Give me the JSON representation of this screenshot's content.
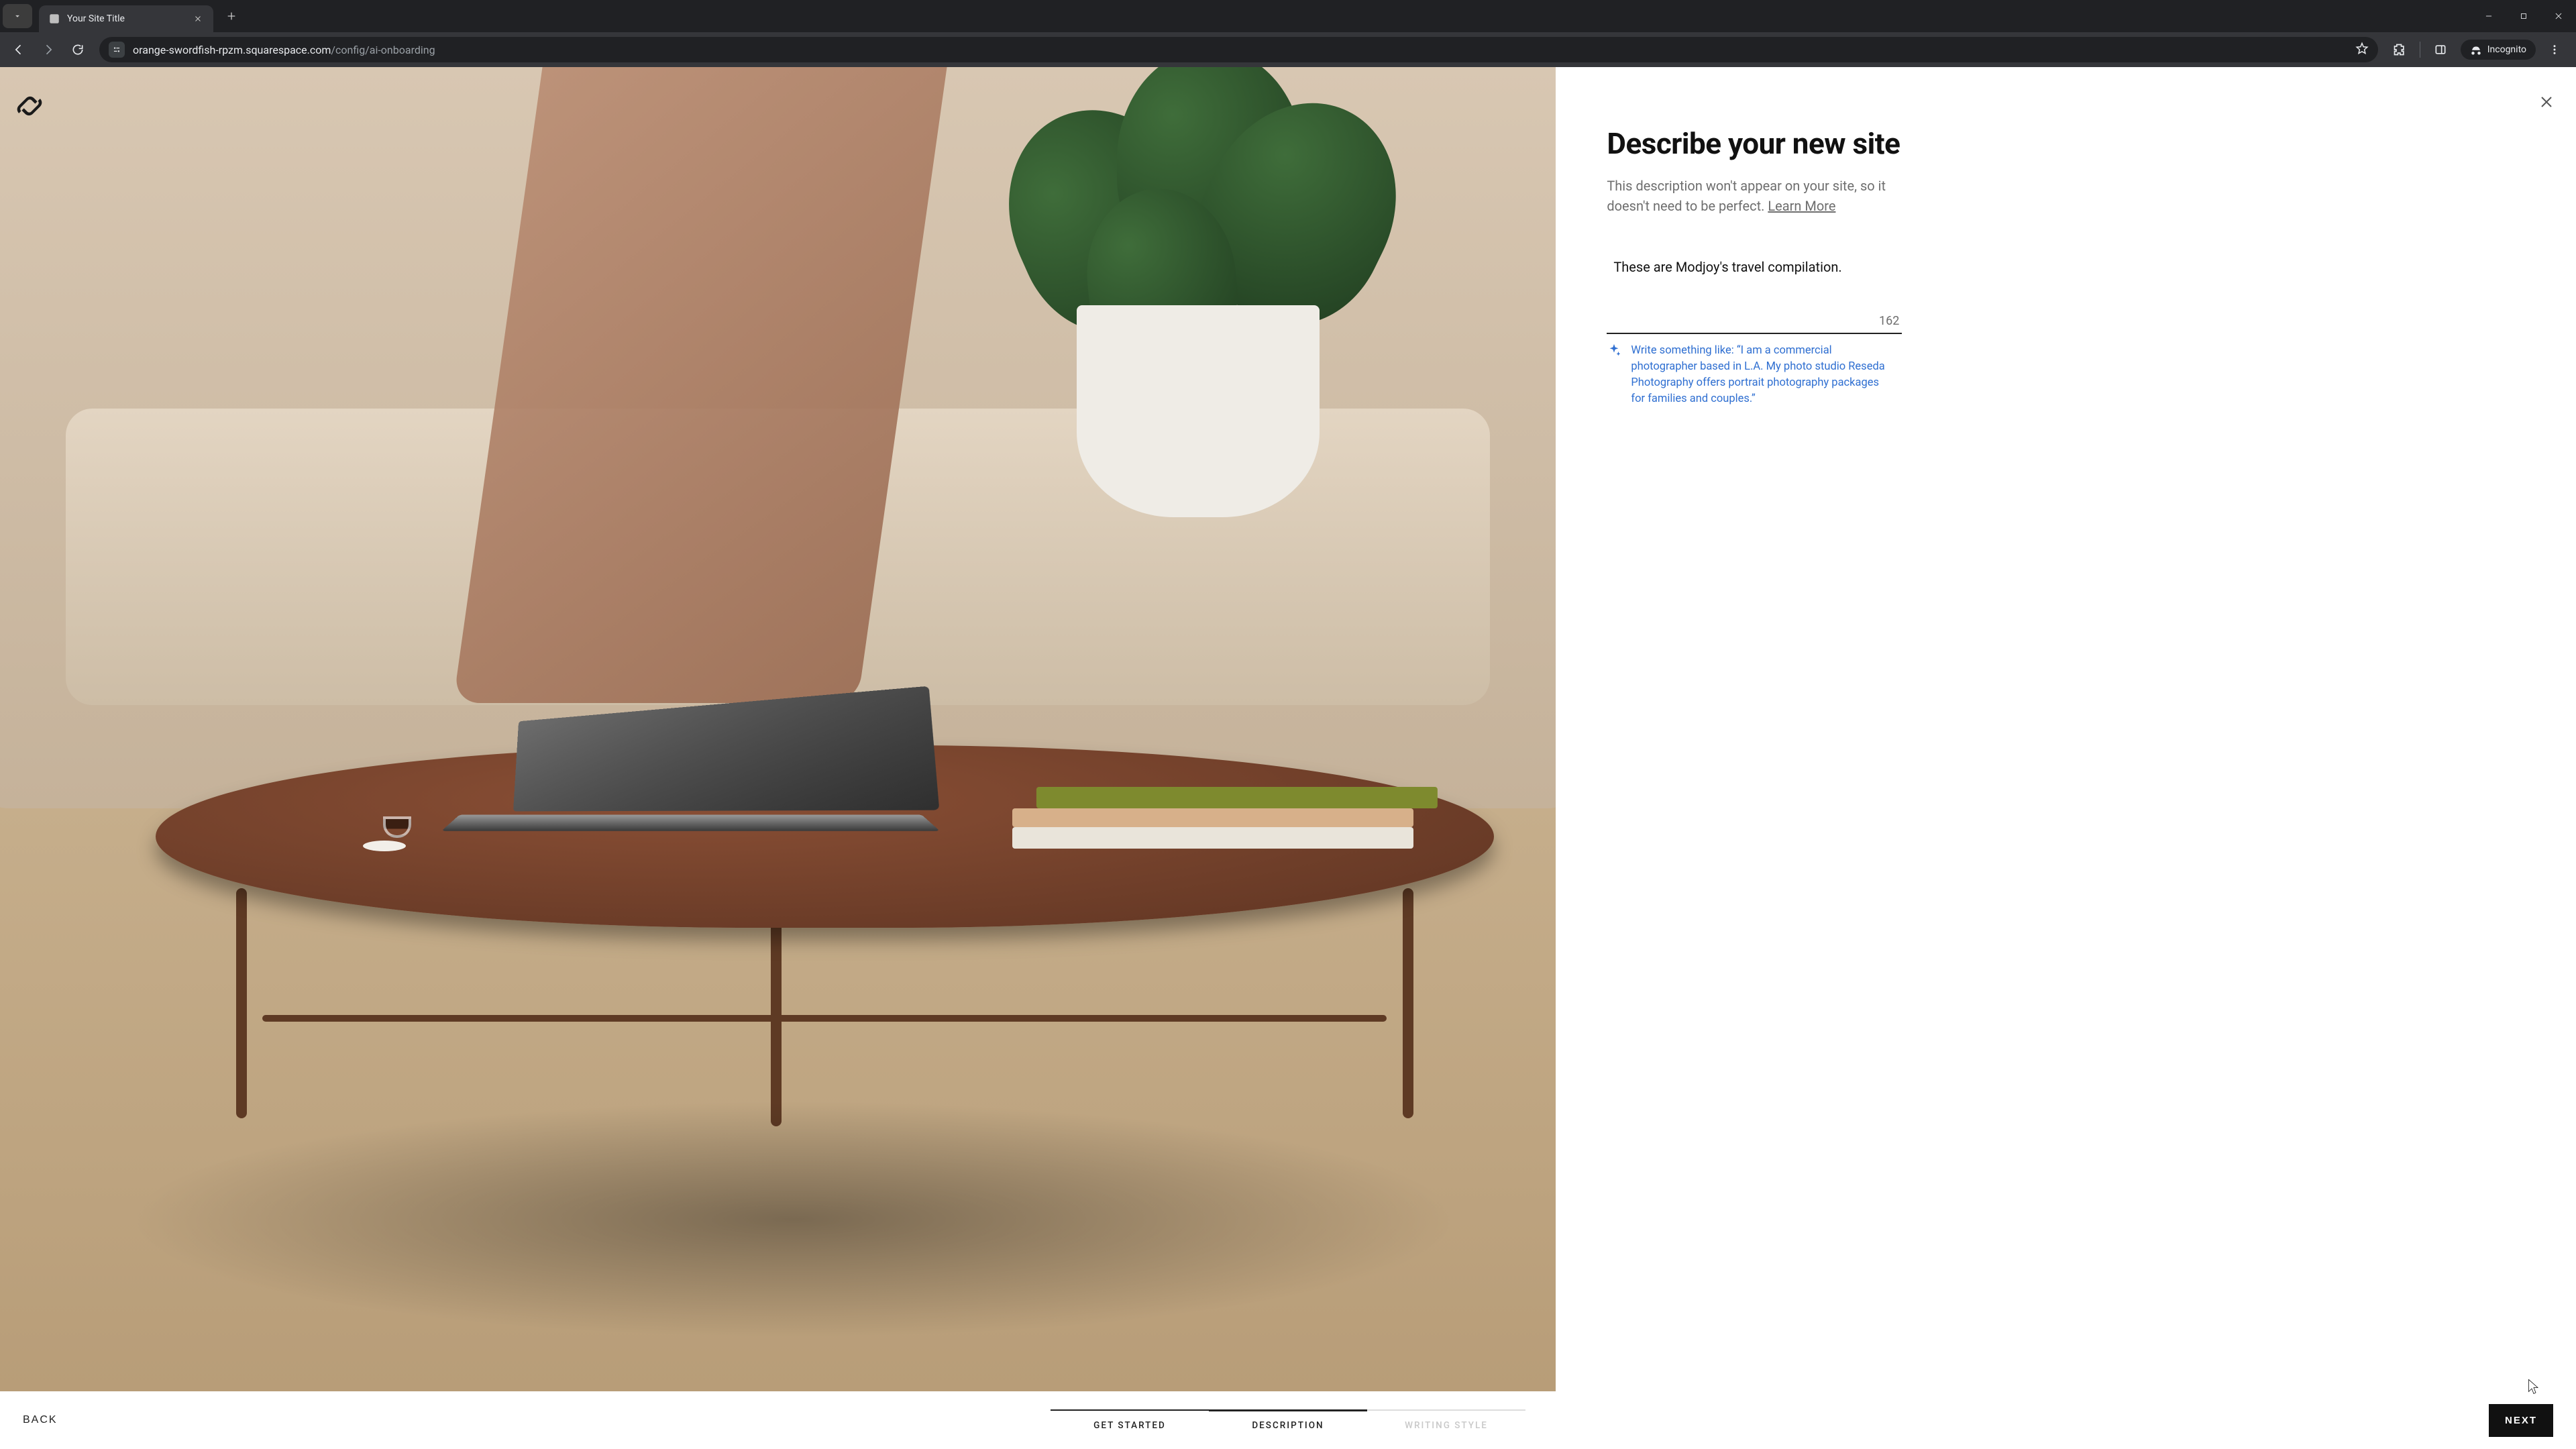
{
  "browser": {
    "tab_title": "Your Site Title",
    "url_host": "orange-swordfish-rpzm.squarespace.com",
    "url_path": "/config/ai-onboarding",
    "incognito_label": "Incognito"
  },
  "panel": {
    "heading": "Describe your new site",
    "subtext_a": "This description won't appear on your site, so it doesn't need to be perfect. ",
    "learn_more": "Learn More",
    "field_value": "These are Modjoy's travel compilation.",
    "char_remaining": "162",
    "hint_text": "Write something like: “I am a commercial photographer based in L.A. My photo studio Reseda Photography offers portrait photography packages for families and couples.”"
  },
  "footer": {
    "back": "BACK",
    "next": "NEXT",
    "steps": {
      "s1": "GET STARTED",
      "s2": "DESCRIPTION",
      "s3": "WRITING STYLE"
    }
  }
}
